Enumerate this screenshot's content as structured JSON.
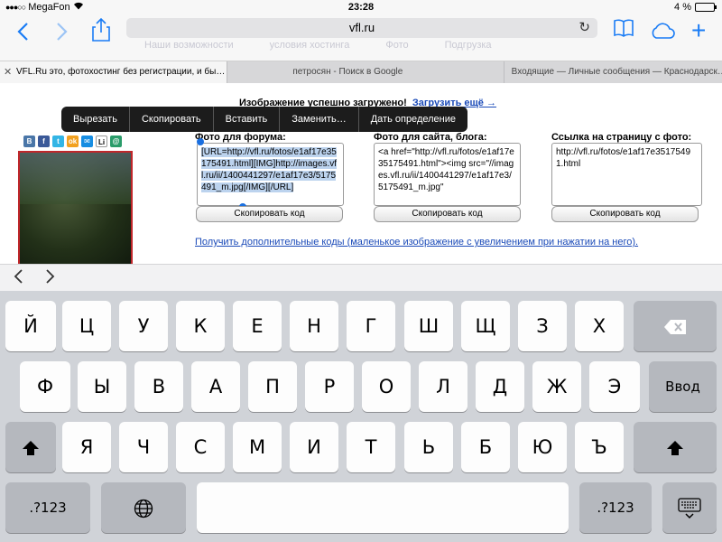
{
  "status": {
    "carrier": "MegaFon",
    "time": "23:28",
    "battery": "4 %"
  },
  "toolbar": {
    "url": "vfl.ru",
    "ghost_nav": [
      "Наши возможности",
      "условия хостинга",
      "Фото",
      "Подгрузка"
    ]
  },
  "tabs": [
    {
      "label": "VFL.Ru это, фотохостинг без регистрации, и бы…",
      "active": true
    },
    {
      "label": "петросян - Поиск в Google",
      "active": false
    },
    {
      "label": "Входящие — Личные сообщения — Краснодарск…",
      "active": false
    }
  ],
  "page": {
    "success_text": "Изображение успешно загружено!",
    "upload_more": "Загрузить ещё →",
    "context_menu": [
      "Вырезать",
      "Скопировать",
      "Вставить",
      "Заменить…",
      "Дать определение"
    ],
    "socials": [
      "B",
      "f",
      "t",
      "ok",
      "✉",
      "Li",
      "@"
    ],
    "columns": [
      {
        "heading": "Фото для форума:",
        "code": "[URL=http://vfl.ru/fotos/e1af17e35175491.html][IMG]http://images.vfl.ru/ii/1400441297/e1af17e3/5175491_m.jpg[/IMG][/URL]",
        "button": "Скопировать код"
      },
      {
        "heading": "Фото для сайта, блога:",
        "code": "<a href=\"http://vfl.ru/fotos/e1af17e35175491.html\"><img src=\"//images.vfl.ru/ii/1400441297/e1af17e3/5175491_m.jpg\"",
        "button": "Скопировать код"
      },
      {
        "heading": "Ссылка на страницу с фото:",
        "code": "http://vfl.ru/fotos/e1af17e35175491.html",
        "button": "Скопировать код"
      }
    ],
    "more_codes": "Получить дополнительные коды (маленькое изображение с увеличением при нажатии на него)."
  },
  "keyboard": {
    "row1": [
      "Й",
      "Ц",
      "У",
      "К",
      "Е",
      "Н",
      "Г",
      "Ш",
      "Щ",
      "З",
      "Х"
    ],
    "row2": [
      "Ф",
      "Ы",
      "В",
      "А",
      "П",
      "Р",
      "О",
      "Л",
      "Д",
      "Ж",
      "Э"
    ],
    "row3": [
      "Я",
      "Ч",
      "С",
      "М",
      "И",
      "Т",
      "Ь",
      "Б",
      "Ю",
      "Ъ"
    ],
    "return_label": "Ввод",
    "numbers_label": ".?123"
  },
  "colors": {
    "accent": "#1a7cf5",
    "link": "#1a4ab8",
    "photo_border": "#c0262a"
  }
}
